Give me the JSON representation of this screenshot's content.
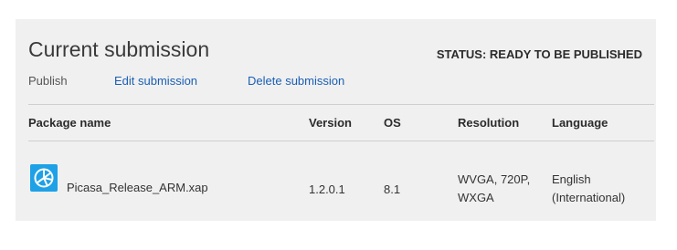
{
  "header": {
    "title": "Current submission",
    "status": "STATUS: READY TO BE PUBLISHED"
  },
  "actions": {
    "publish_label": "Publish",
    "edit_label": "Edit submission",
    "delete_label": "Delete submission"
  },
  "table": {
    "columns": [
      "Package name",
      "Version",
      "OS",
      "Resolution",
      "Language"
    ],
    "rows": [
      {
        "icon": "picasa-app-icon",
        "package_name": "Picasa_Release_ARM.xap",
        "version": "1.2.0.1",
        "os": "8.1",
        "resolution_line1": "WVGA, 720P,",
        "resolution_line2": "WXGA",
        "language_line1": "English",
        "language_line2": "(International)"
      }
    ]
  },
  "colors": {
    "panel_bg": "#f0f0f0",
    "link": "#1a5fb4",
    "icon_bg": "#1ea1e6"
  }
}
